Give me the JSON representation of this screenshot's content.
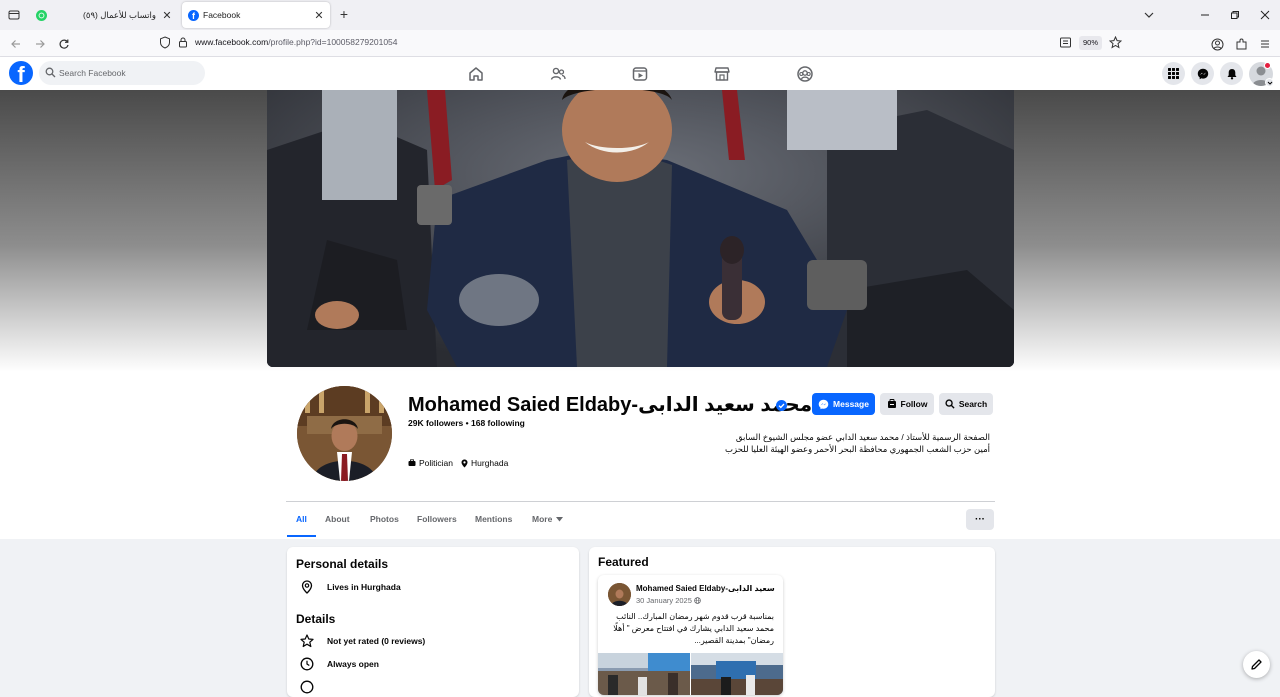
{
  "browser": {
    "tabs": [
      {
        "title": "واتساب للأعمال (٥٩)",
        "active": false,
        "favicon": "whatsapp-icon"
      },
      {
        "title": "Facebook",
        "active": true,
        "favicon": "facebook-icon"
      }
    ],
    "url_host": "www.facebook.com",
    "url_path": "/profile.php?id=100058279201054",
    "zoom": "90%"
  },
  "fb": {
    "search_placeholder": "Search Facebook",
    "brand_color": "#0866ff"
  },
  "profile": {
    "name": "Mohamed Saied Eldaby-محمد سعيد الدابى",
    "followers": "29K followers",
    "following": "168 following",
    "bio_line1": "الصفحة الرسمية للأستاذ / محمد سعيد الدابي عضو مجلس الشيوخ السابق",
    "bio_line2": "أمين حزب الشعب الجمهوري محافظة البحر الأحمر وعضو الهيئة العليا للحزب",
    "category": "Politician",
    "location": "Hurghada",
    "buttons": {
      "message": "Message",
      "follow": "Follow",
      "search": "Search"
    }
  },
  "tabs": [
    "All",
    "About",
    "Photos",
    "Followers",
    "Mentions",
    "More"
  ],
  "personal_details": {
    "title": "Personal details",
    "lives_in": "Lives in Hurghada"
  },
  "details": {
    "title": "Details",
    "rating": "Not yet rated (0 reviews)",
    "hours": "Always open"
  },
  "featured": {
    "title": "Featured",
    "post_author": "Mohamed Saied Eldaby-سعيد الدابى",
    "post_date": "30 January 2025",
    "post_text": "بمناسبة قرب قدوم شهر رمضان المبارك.. النائب محمد سعيد الدابي يشارك في افتتاح معرض \" أهلًا رمضان\" بمدينة القصير..."
  }
}
